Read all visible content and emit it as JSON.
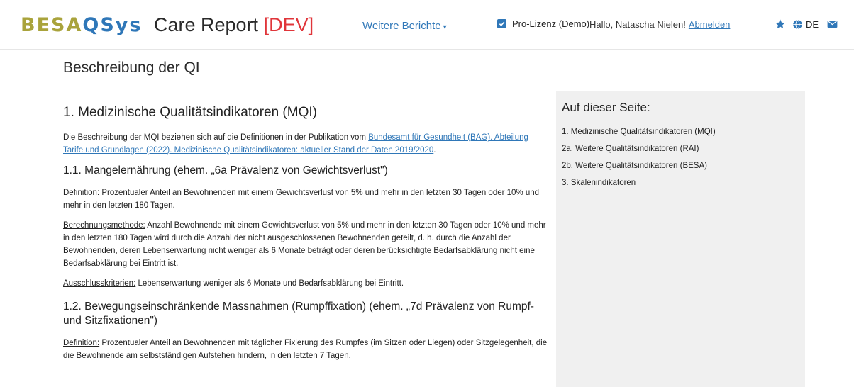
{
  "header": {
    "logo_part1": "BESA",
    "logo_part2": "QSys",
    "title": "Care Report",
    "title_tag": "[DEV]",
    "reports_menu": "Weitere Berichte",
    "license_label": "Pro-Lizenz (Demo)",
    "greeting": "Hallo, Natascha Nielen!",
    "logout": "Abmelden",
    "language": "DE",
    "icons": [
      "star-icon",
      "globe-icon",
      "mail-icon"
    ]
  },
  "page": {
    "title": "Beschreibung der QI"
  },
  "content": {
    "section1_heading": "1. Medizinische Qualitätsindikatoren (MQI)",
    "section1_intro_prefix": "Die Beschreibung der MQI beziehen sich auf die Definitionen in der Publikation vom ",
    "section1_intro_link": "Bundesamt für Gesundheit (BAG), Abteilung Tarife und Grundlagen (2022). Medizinische Qualitätsindikatoren: aktueller Stand der Daten 2019/2020",
    "section1_intro_suffix": ".",
    "sub11_heading": "1.1. Mangelernährung (ehem. „6a Prävalenz von Gewichtsverlust\")",
    "sub11_def_label": "Definition:",
    "sub11_def_text": " Prozentualer Anteil an Bewohnenden mit einem Gewichtsverlust von 5% und mehr in den letzten 30 Tagen oder 10% und mehr in den letzten 180 Tagen.",
    "sub11_calc_label": "Berechnungsmethode:",
    "sub11_calc_text": " Anzahl Bewohnende mit einem Gewichtsverlust von 5% und mehr in den letzten 30 Tagen oder 10% und mehr in den letzten 180 Tagen wird durch die Anzahl der nicht ausgeschlossenen Bewohnenden geteilt, d. h. durch die Anzahl der Bewohnenden, deren Lebenserwartung nicht weniger als 6 Monate beträgt oder deren berücksichtigte Bedarfsabklärung nicht eine Bedarfsabklärung bei Eintritt ist.",
    "sub11_excl_label": "Ausschlusskriterien:",
    "sub11_excl_text": " Lebenserwartung weniger als 6 Monate und Bedarfsabklärung bei Eintritt.",
    "sub12_heading": "1.2. Bewegungseinschränkende Massnahmen (Rumpffixation) (ehem. „7d Prävalenz von Rumpf- und Sitzfixationen\")",
    "sub12_def_label": "Definition:",
    "sub12_def_text": " Prozentualer Anteil an Bewohnenden mit täglicher Fixierung des Rumpfes (im Sitzen oder Liegen) oder Sitzgelegenheit, die die Bewohnende am selbstständigen Aufstehen hindern, in den letzten 7 Tagen."
  },
  "toc": {
    "heading": "Auf dieser Seite:",
    "items": [
      "1. Medizinische Qualitätsindikatoren (MQI)",
      "2a. Weitere Qualitätsindikatoren (RAI)",
      "2b. Weitere Qualitätsindikatoren (BESA)",
      "3. Skalenindikatoren"
    ]
  },
  "colors": {
    "logo_olive": "#a9a33b",
    "logo_blue": "#2f77b8",
    "dev_red": "#e0353a",
    "link_blue": "#2f77b8",
    "sidebar_bg": "#f0f0f0"
  }
}
